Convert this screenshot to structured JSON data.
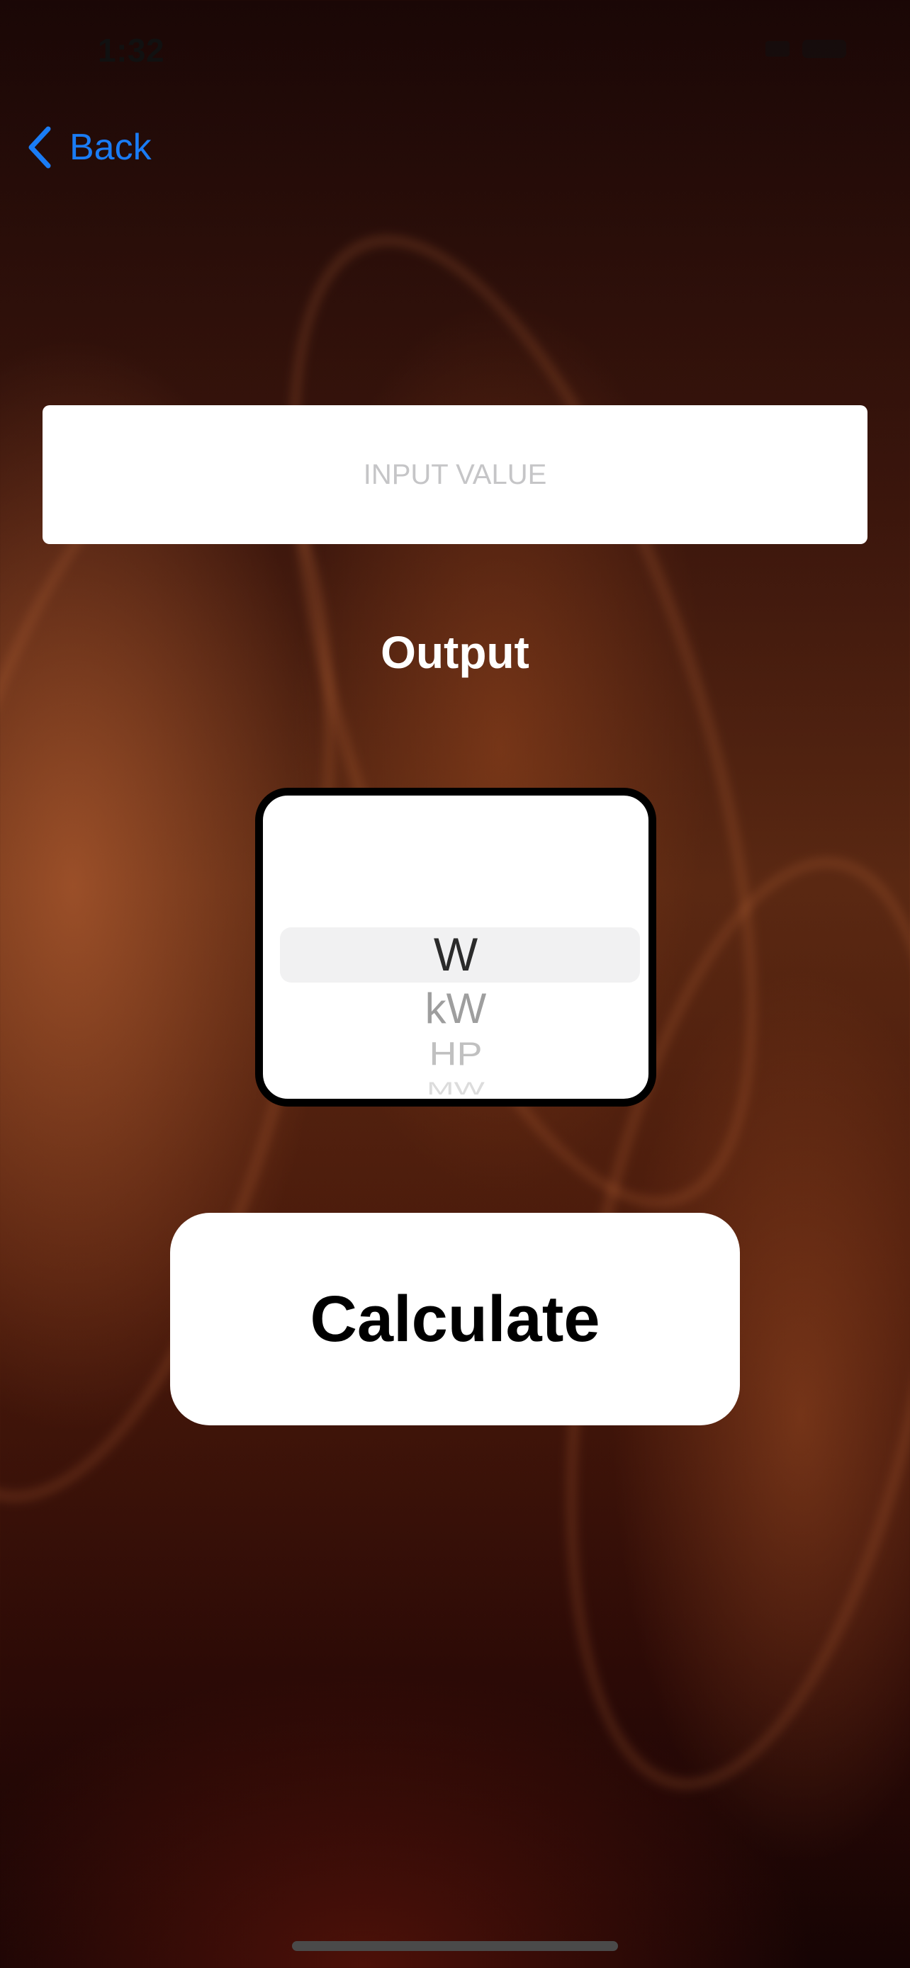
{
  "status_bar": {
    "time": "1:32"
  },
  "nav": {
    "back_label": "Back"
  },
  "input": {
    "placeholder": "INPUT VALUE",
    "value": ""
  },
  "output": {
    "label": "Output"
  },
  "unit_picker": {
    "items": [
      "W",
      "kW",
      "HP",
      "MW"
    ],
    "selected": "W"
  },
  "actions": {
    "calculate_label": "Calculate"
  },
  "colors": {
    "accent": "#1a7cf5",
    "background": "#4a1a0b"
  }
}
